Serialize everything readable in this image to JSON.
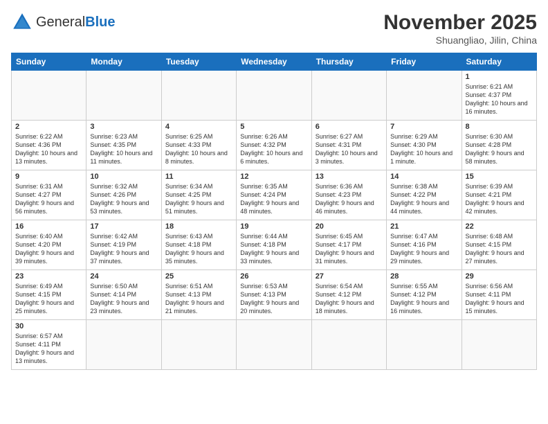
{
  "header": {
    "logo_general": "General",
    "logo_blue": "Blue",
    "title": "November 2025",
    "location": "Shuangliao, Jilin, China"
  },
  "days_of_week": [
    "Sunday",
    "Monday",
    "Tuesday",
    "Wednesday",
    "Thursday",
    "Friday",
    "Saturday"
  ],
  "weeks": [
    [
      {
        "day": "",
        "info": ""
      },
      {
        "day": "",
        "info": ""
      },
      {
        "day": "",
        "info": ""
      },
      {
        "day": "",
        "info": ""
      },
      {
        "day": "",
        "info": ""
      },
      {
        "day": "",
        "info": ""
      },
      {
        "day": "1",
        "info": "Sunrise: 6:21 AM\nSunset: 4:37 PM\nDaylight: 10 hours and 16 minutes."
      }
    ],
    [
      {
        "day": "2",
        "info": "Sunrise: 6:22 AM\nSunset: 4:36 PM\nDaylight: 10 hours and 13 minutes."
      },
      {
        "day": "3",
        "info": "Sunrise: 6:23 AM\nSunset: 4:35 PM\nDaylight: 10 hours and 11 minutes."
      },
      {
        "day": "4",
        "info": "Sunrise: 6:25 AM\nSunset: 4:33 PM\nDaylight: 10 hours and 8 minutes."
      },
      {
        "day": "5",
        "info": "Sunrise: 6:26 AM\nSunset: 4:32 PM\nDaylight: 10 hours and 6 minutes."
      },
      {
        "day": "6",
        "info": "Sunrise: 6:27 AM\nSunset: 4:31 PM\nDaylight: 10 hours and 3 minutes."
      },
      {
        "day": "7",
        "info": "Sunrise: 6:29 AM\nSunset: 4:30 PM\nDaylight: 10 hours and 1 minute."
      },
      {
        "day": "8",
        "info": "Sunrise: 6:30 AM\nSunset: 4:28 PM\nDaylight: 9 hours and 58 minutes."
      }
    ],
    [
      {
        "day": "9",
        "info": "Sunrise: 6:31 AM\nSunset: 4:27 PM\nDaylight: 9 hours and 56 minutes."
      },
      {
        "day": "10",
        "info": "Sunrise: 6:32 AM\nSunset: 4:26 PM\nDaylight: 9 hours and 53 minutes."
      },
      {
        "day": "11",
        "info": "Sunrise: 6:34 AM\nSunset: 4:25 PM\nDaylight: 9 hours and 51 minutes."
      },
      {
        "day": "12",
        "info": "Sunrise: 6:35 AM\nSunset: 4:24 PM\nDaylight: 9 hours and 48 minutes."
      },
      {
        "day": "13",
        "info": "Sunrise: 6:36 AM\nSunset: 4:23 PM\nDaylight: 9 hours and 46 minutes."
      },
      {
        "day": "14",
        "info": "Sunrise: 6:38 AM\nSunset: 4:22 PM\nDaylight: 9 hours and 44 minutes."
      },
      {
        "day": "15",
        "info": "Sunrise: 6:39 AM\nSunset: 4:21 PM\nDaylight: 9 hours and 42 minutes."
      }
    ],
    [
      {
        "day": "16",
        "info": "Sunrise: 6:40 AM\nSunset: 4:20 PM\nDaylight: 9 hours and 39 minutes."
      },
      {
        "day": "17",
        "info": "Sunrise: 6:42 AM\nSunset: 4:19 PM\nDaylight: 9 hours and 37 minutes."
      },
      {
        "day": "18",
        "info": "Sunrise: 6:43 AM\nSunset: 4:18 PM\nDaylight: 9 hours and 35 minutes."
      },
      {
        "day": "19",
        "info": "Sunrise: 6:44 AM\nSunset: 4:18 PM\nDaylight: 9 hours and 33 minutes."
      },
      {
        "day": "20",
        "info": "Sunrise: 6:45 AM\nSunset: 4:17 PM\nDaylight: 9 hours and 31 minutes."
      },
      {
        "day": "21",
        "info": "Sunrise: 6:47 AM\nSunset: 4:16 PM\nDaylight: 9 hours and 29 minutes."
      },
      {
        "day": "22",
        "info": "Sunrise: 6:48 AM\nSunset: 4:15 PM\nDaylight: 9 hours and 27 minutes."
      }
    ],
    [
      {
        "day": "23",
        "info": "Sunrise: 6:49 AM\nSunset: 4:15 PM\nDaylight: 9 hours and 25 minutes."
      },
      {
        "day": "24",
        "info": "Sunrise: 6:50 AM\nSunset: 4:14 PM\nDaylight: 9 hours and 23 minutes."
      },
      {
        "day": "25",
        "info": "Sunrise: 6:51 AM\nSunset: 4:13 PM\nDaylight: 9 hours and 21 minutes."
      },
      {
        "day": "26",
        "info": "Sunrise: 6:53 AM\nSunset: 4:13 PM\nDaylight: 9 hours and 20 minutes."
      },
      {
        "day": "27",
        "info": "Sunrise: 6:54 AM\nSunset: 4:12 PM\nDaylight: 9 hours and 18 minutes."
      },
      {
        "day": "28",
        "info": "Sunrise: 6:55 AM\nSunset: 4:12 PM\nDaylight: 9 hours and 16 minutes."
      },
      {
        "day": "29",
        "info": "Sunrise: 6:56 AM\nSunset: 4:11 PM\nDaylight: 9 hours and 15 minutes."
      }
    ],
    [
      {
        "day": "30",
        "info": "Sunrise: 6:57 AM\nSunset: 4:11 PM\nDaylight: 9 hours and 13 minutes."
      },
      {
        "day": "",
        "info": ""
      },
      {
        "day": "",
        "info": ""
      },
      {
        "day": "",
        "info": ""
      },
      {
        "day": "",
        "info": ""
      },
      {
        "day": "",
        "info": ""
      },
      {
        "day": "",
        "info": ""
      }
    ]
  ]
}
